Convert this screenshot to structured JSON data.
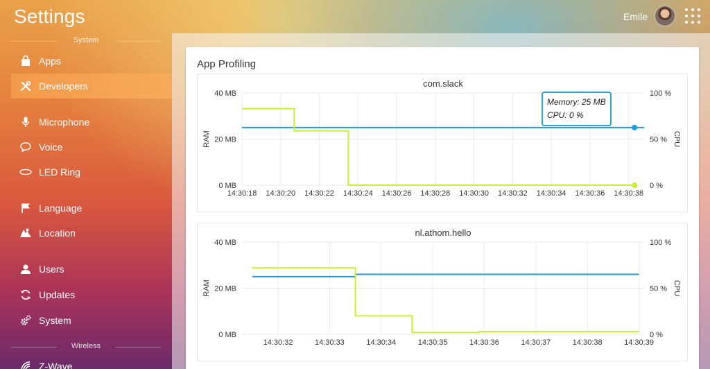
{
  "app": {
    "title": "Settings"
  },
  "user": {
    "name": "Emile"
  },
  "sidebar": {
    "sections": [
      {
        "label": "System"
      },
      {
        "label": "Wireless"
      }
    ],
    "items": [
      {
        "label": "Apps",
        "icon": "bag-icon",
        "active": false
      },
      {
        "label": "Developers",
        "icon": "tools-icon",
        "active": true
      },
      {
        "label": "Microphone",
        "icon": "microphone-icon",
        "active": false
      },
      {
        "label": "Voice",
        "icon": "speech-bubble-icon",
        "active": false
      },
      {
        "label": "LED Ring",
        "icon": "ring-icon",
        "active": false
      },
      {
        "label": "Language",
        "icon": "flag-icon",
        "active": false
      },
      {
        "label": "Location",
        "icon": "map-icon",
        "active": false
      },
      {
        "label": "Users",
        "icon": "user-icon",
        "active": false
      },
      {
        "label": "Updates",
        "icon": "refresh-icon",
        "active": false
      },
      {
        "label": "System",
        "icon": "gears-icon",
        "active": false
      },
      {
        "label": "Z-Wave",
        "icon": "signal-icon",
        "active": false
      }
    ]
  },
  "main": {
    "title": "App Profiling"
  },
  "colors": {
    "memory": "#1e9be0",
    "cpu": "#c8f032",
    "accent": "#f29a4a",
    "tooltip_border": "#2aa5e0"
  },
  "chart_data": [
    {
      "type": "line",
      "title": "com.slack",
      "ylabel": "RAM",
      "y2label": "CPU",
      "ylim": [
        0,
        40
      ],
      "y2lim": [
        0,
        100
      ],
      "yticks": [
        "0 MB",
        "20 MB",
        "40 MB"
      ],
      "y2ticks": [
        "0 %",
        "50 %",
        "100 %"
      ],
      "x_ticks": [
        "14:30:18",
        "14:30:20",
        "14:30:22",
        "14:30:24",
        "14:30:26",
        "14:30:28",
        "14:30:30",
        "14:30:32",
        "14:30:34",
        "14:30:36",
        "14:30:38"
      ],
      "xlim": [
        0,
        20.8
      ],
      "series": [
        {
          "name": "Memory",
          "axis": "left",
          "step": false,
          "x": [
            0,
            20.8
          ],
          "values": [
            25,
            25
          ]
        },
        {
          "name": "CPU",
          "axis": "right",
          "step": true,
          "x": [
            0,
            2.7,
            5.5,
            20.3
          ],
          "values": [
            83,
            59,
            0,
            0
          ]
        }
      ],
      "marker_x": 20.3,
      "tooltip": {
        "memory": "Memory: 25 MB",
        "cpu": "CPU: 0 %"
      }
    },
    {
      "type": "line",
      "title": "nl.athom.hello",
      "ylabel": "RAM",
      "y2label": "CPU",
      "ylim": [
        0,
        40
      ],
      "y2lim": [
        0,
        100
      ],
      "yticks": [
        "0 MB",
        "20 MB",
        "40 MB"
      ],
      "y2ticks": [
        "0 %",
        "50 %",
        "100 %"
      ],
      "x_ticks": [
        "14:30:32",
        "14:30:33",
        "14:30:34",
        "14:30:35",
        "14:30:36",
        "14:30:37",
        "14:30:38",
        "14:30:39"
      ],
      "xlim": [
        -0.7,
        7.1
      ],
      "series": [
        {
          "name": "Memory",
          "axis": "left",
          "step": true,
          "x": [
            -0.5,
            1.5,
            7.0
          ],
          "values": [
            25,
            26,
            26
          ]
        },
        {
          "name": "CPU",
          "axis": "right",
          "step": true,
          "x": [
            -0.5,
            1.5,
            2.6,
            3.9,
            7.0
          ],
          "values": [
            72,
            20,
            2,
            3,
            3
          ]
        }
      ]
    }
  ]
}
